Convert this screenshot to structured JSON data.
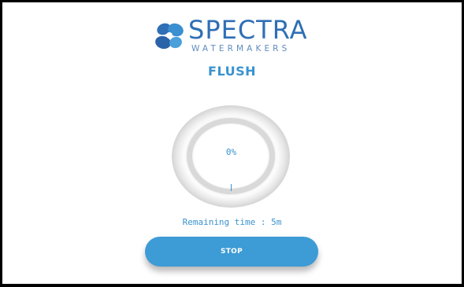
{
  "logo": {
    "name": "SPECTRA",
    "tagline": "WATERMAKERS",
    "icon": "propeller-logo-icon"
  },
  "mode": {
    "title": "FLUSH"
  },
  "gauge": {
    "label": "0%",
    "progress": 0
  },
  "remaining": {
    "text": "Remaining time : 5m"
  },
  "actions": {
    "stop_label": "STOP"
  },
  "colors": {
    "brand_blue": "#2f6fb5",
    "accent_blue": "#3a93cf",
    "button_blue": "#3d9bd5"
  }
}
